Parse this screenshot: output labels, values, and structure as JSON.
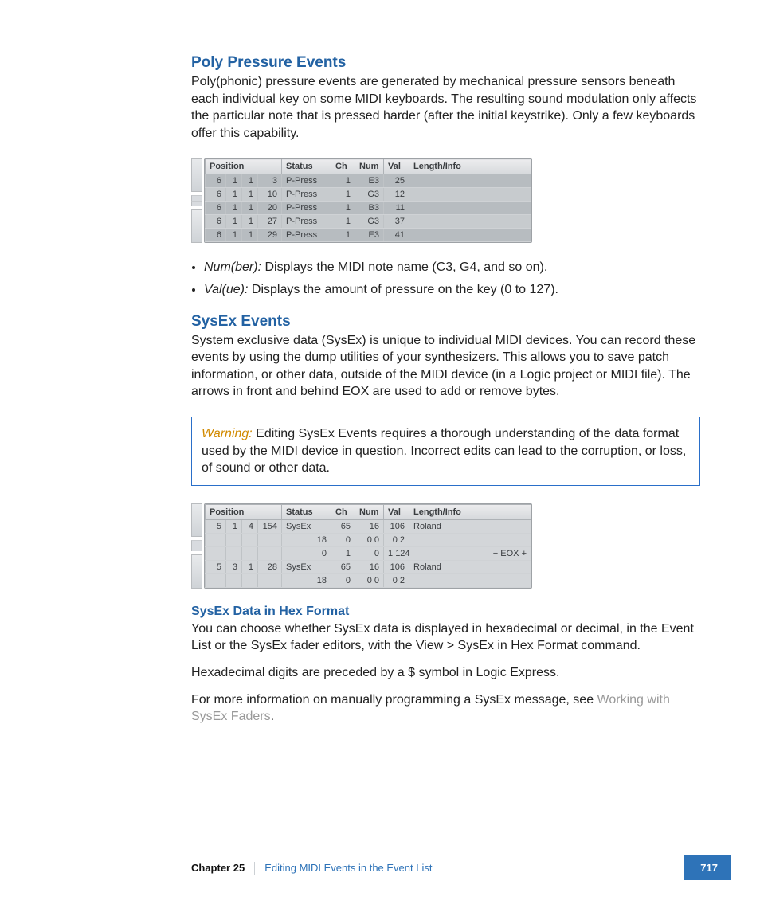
{
  "sections": {
    "poly": {
      "title": "Poly Pressure Events",
      "intro": "Poly(phonic) pressure events are generated by mechanical pressure sensors beneath each individual key on some MIDI keyboards. The resulting sound modulation only affects the particular note that is pressed harder (after the initial keystrike). Only a few keyboards offer this capability."
    },
    "bullets": {
      "num_label": "Num(ber):",
      "num_text": "  Displays the MIDI note name (C3, G4, and so on).",
      "val_label": "Val(ue):",
      "val_text": "  Displays the amount of pressure on the key (0 to 127)."
    },
    "sysex": {
      "title": "SysEx Events",
      "intro": "System exclusive data (SysEx) is unique to individual MIDI devices. You can record these events by using the dump utilities of your synthesizers. This allows you to save patch information, or other data, outside of the MIDI device (in a Logic project or MIDI file). The arrows in front and behind EOX are used to add or remove bytes."
    },
    "warning": {
      "label": "Warning:",
      "text": "  Editing SysEx Events requires a thorough understanding of the data format used by the MIDI device in question. Incorrect edits can lead to the corruption, or loss, of sound or other data."
    },
    "hex": {
      "title": "SysEx Data in Hex Format",
      "p1": "You can choose whether SysEx data is displayed in hexadecimal or decimal, in the Event List or the SysEx fader editors, with the View > SysEx in Hex Format command.",
      "p2": "Hexadecimal digits are preceded by a $ symbol in Logic Express.",
      "p3a": "For more information on manually programming a SysEx message, see ",
      "p3_link": "Working with SysEx Faders",
      "p3b": "."
    }
  },
  "table1": {
    "headers": {
      "pos": "Position",
      "status": "Status",
      "ch": "Ch",
      "num": "Num",
      "val": "Val",
      "info": "Length/Info"
    },
    "rows": [
      {
        "p1": "6",
        "p2": "1",
        "p3": "1",
        "p4": "3",
        "status": "P-Press",
        "ch": "1",
        "num": "E3",
        "val": "25"
      },
      {
        "p1": "6",
        "p2": "1",
        "p3": "1",
        "p4": "10",
        "status": "P-Press",
        "ch": "1",
        "num": "G3",
        "val": "12"
      },
      {
        "p1": "6",
        "p2": "1",
        "p3": "1",
        "p4": "20",
        "status": "P-Press",
        "ch": "1",
        "num": "B3",
        "val": "11"
      },
      {
        "p1": "6",
        "p2": "1",
        "p3": "1",
        "p4": "27",
        "status": "P-Press",
        "ch": "1",
        "num": "G3",
        "val": "37"
      },
      {
        "p1": "6",
        "p2": "1",
        "p3": "1",
        "p4": "29",
        "status": "P-Press",
        "ch": "1",
        "num": "E3",
        "val": "41"
      }
    ]
  },
  "table2": {
    "headers": {
      "pos": "Position",
      "status": "Status",
      "ch": "Ch",
      "num": "Num",
      "val": "Val",
      "info": "Length/Info"
    },
    "rows": [
      {
        "p1": "5",
        "p2": "1",
        "p3": "4",
        "p4": "154",
        "status": "SysEx",
        "ch": "65",
        "num": "16",
        "val": "106",
        "info": "Roland"
      },
      {
        "p1": "",
        "p2": "",
        "p3": "",
        "p4": "",
        "status": "18",
        "ch": "0",
        "num": "0   0",
        "val": "0    2",
        "info": ""
      },
      {
        "p1": "",
        "p2": "",
        "p3": "",
        "p4": "",
        "status": "0",
        "ch": "1",
        "num": "0",
        "val": "1 124",
        "info": "",
        "eox": "− EOX +"
      },
      {
        "p1": "5",
        "p2": "3",
        "p3": "1",
        "p4": "28",
        "status": "SysEx",
        "ch": "65",
        "num": "16",
        "val": "106",
        "info": "Roland"
      },
      {
        "p1": "",
        "p2": "",
        "p3": "",
        "p4": "",
        "status": "18",
        "ch": "0",
        "num": "0   0",
        "val": "0    2",
        "info": ""
      }
    ]
  },
  "footer": {
    "chapter": "Chapter 25",
    "title": "Editing MIDI Events in the Event List",
    "page": "717"
  }
}
